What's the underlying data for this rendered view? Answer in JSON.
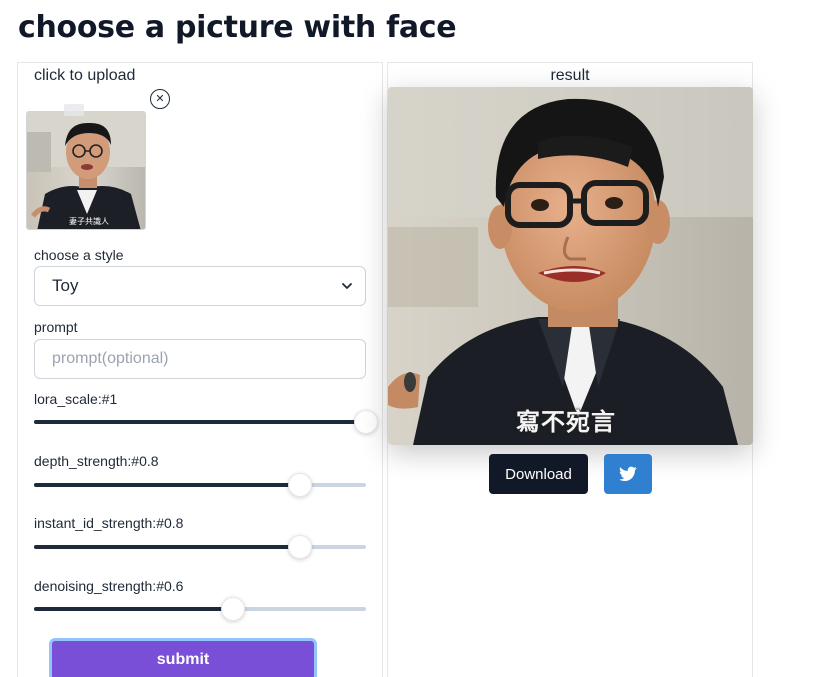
{
  "header": {
    "title": "choose a picture with face"
  },
  "upload": {
    "label": "click to upload",
    "close_icon": "close-icon",
    "thumb_caption": "妻子共識人"
  },
  "style_select": {
    "label": "choose a style",
    "selected": "Toy",
    "icon": "chevron-down-icon"
  },
  "prompt": {
    "label": "prompt",
    "value": "",
    "placeholder": "prompt(optional)"
  },
  "sliders": [
    {
      "label": "lora_scale:#1",
      "value": 1
    },
    {
      "label": "depth_strength:#0.8",
      "value": 0.8
    },
    {
      "label": "instant_id_strength:#0.8",
      "value": 0.8
    },
    {
      "label": "denoising_strength:#0.6",
      "value": 0.6
    }
  ],
  "submit": {
    "label": "submit"
  },
  "result": {
    "label": "result",
    "caption": "寫不宛言",
    "download_label": "Download",
    "share_icon": "twitter-icon"
  },
  "colors": {
    "submit_bg": "#7a4fd8",
    "download_bg": "#111827",
    "twitter_bg": "#2f80d1",
    "slider_fill": "#1e293b",
    "slider_track": "#cbd5e1"
  }
}
